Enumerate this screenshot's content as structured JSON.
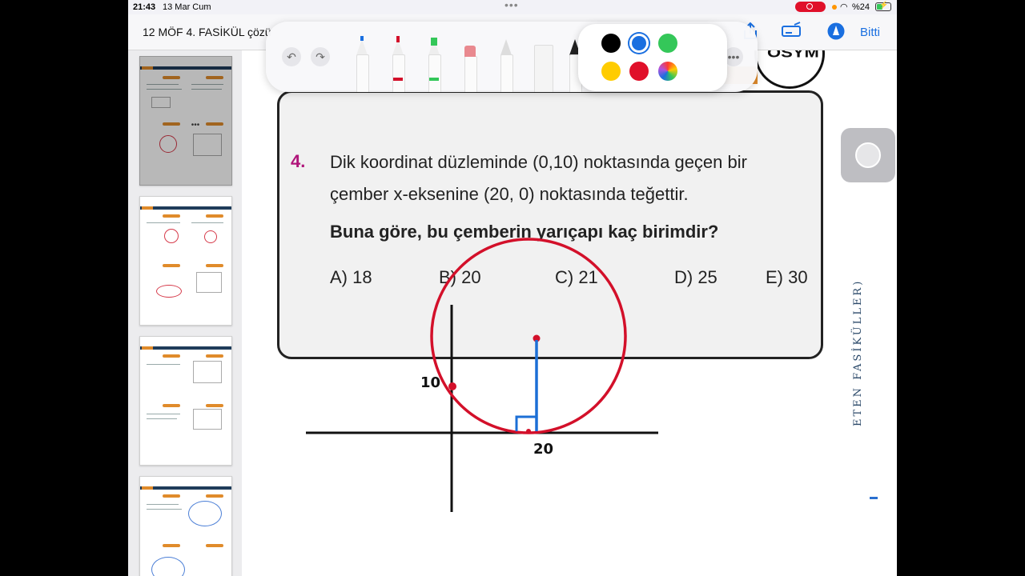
{
  "status": {
    "time": "21:43",
    "date": "13 Mar Cum",
    "battery": "%24"
  },
  "nav": {
    "title": "12 MÖF 4. FASİKÜL çözü",
    "done": "Bitti"
  },
  "question": {
    "number": "4.",
    "line1": "Dik koordinat düzleminde (0,10) noktasında geçen bir",
    "line2": "çember x-eksenine (20, 0) noktasında teğettir.",
    "prompt": "Buna göre, bu çemberin yarıçapı kaç birimdir?",
    "choices": [
      "A) 18",
      "B) 20",
      "C) 21",
      "D) 25",
      "E) 30"
    ]
  },
  "logo_text": "ÖSYM",
  "side_text": "ETEN FASİKÜLLER)",
  "drawing": {
    "label_y": "10",
    "label_x": "20"
  },
  "colors": {
    "ink_red": "#d3102a",
    "ink_blue": "#1c6fd6",
    "accent": "#1a6fe0"
  },
  "palette": [
    "#000000",
    "#1a6fe0",
    "#34c759",
    "#ffcc00",
    "#e0102a",
    "multicolor"
  ],
  "tools": [
    "pen",
    "marker",
    "highlighter",
    "eraser",
    "lasso",
    "ruler",
    "fountain-pen"
  ]
}
